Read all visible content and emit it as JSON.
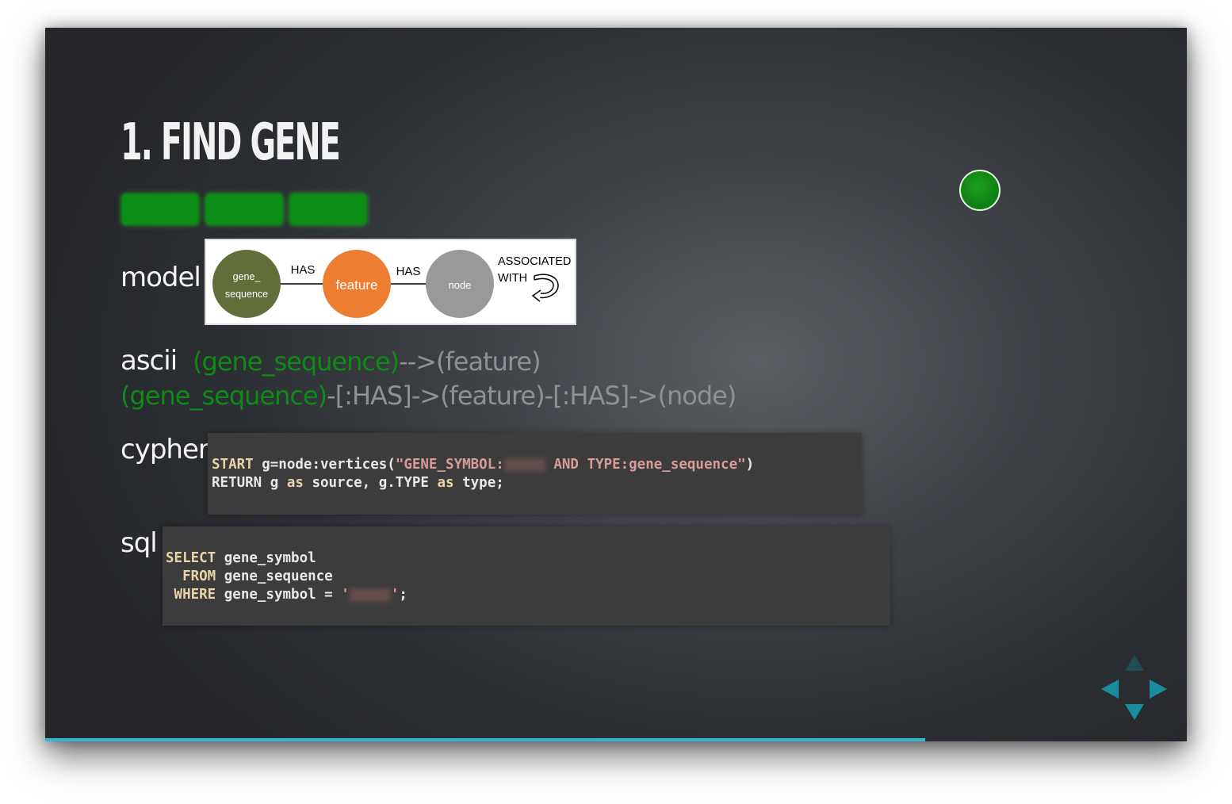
{
  "slide": {
    "title": "1. FIND GENE",
    "badge_count": 3,
    "progress_fraction": 0.771
  },
  "labels": {
    "model": "model",
    "ascii": "ascii",
    "cypher": "cypher",
    "sql": "sql"
  },
  "model_diagram": {
    "nodes": [
      {
        "label_line1": "gene_",
        "label_line2": "sequence",
        "color": "#606f3a"
      },
      {
        "label": "feature",
        "color": "#ed7d31"
      },
      {
        "label": "node",
        "color": "#999999"
      }
    ],
    "edges": [
      "HAS",
      "HAS"
    ],
    "self_loop_line1": "ASSOCIATED",
    "self_loop_line2": "WITH"
  },
  "ascii": {
    "line1_green": "(gene_sequence)",
    "line1_rest": "-->(feature)",
    "line2_green": "(gene_sequence)",
    "line2_rest": "-[:HAS]->(feature)-[:HAS]->(node)"
  },
  "cypher": {
    "kw_start": "START",
    "part1": " g=node:vertices(",
    "str_a": "\"GENE_SYMBOL:",
    "str_b": " AND TYPE:gene_sequence\"",
    "part2": ")",
    "line2_a": "RETURN g ",
    "kw_as1": "as",
    "line2_b": " source, g.TYPE ",
    "kw_as2": "as",
    "line2_c": " type;"
  },
  "sql": {
    "kw_select": "SELECT",
    "select_rest": " gene_symbol",
    "kw_from": "  FROM",
    "from_rest": " gene_sequence",
    "kw_where": " WHERE",
    "where_rest": " gene_symbol = ",
    "quote_open": "'",
    "quote_close": "'",
    "terminator": ";"
  },
  "colors": {
    "accent_green": "#0f8a16",
    "progress": "#2fb7d4",
    "nav_arrow": "#1a8ca0"
  }
}
